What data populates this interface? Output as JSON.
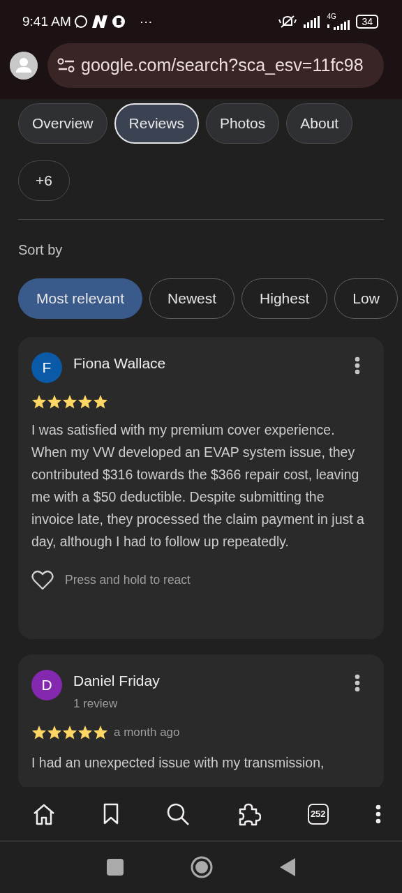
{
  "status_bar": {
    "time": "9:41 AM",
    "more": "···",
    "network": "4G",
    "battery": "34"
  },
  "address_bar": {
    "url": "google.com/search?sca_esv=11fc98"
  },
  "tabs": [
    {
      "label": "Overview",
      "selected": false
    },
    {
      "label": "Reviews",
      "selected": true
    },
    {
      "label": "Photos",
      "selected": false
    },
    {
      "label": "About",
      "selected": false
    }
  ],
  "more_tabs": "+6",
  "sort": {
    "label": "Sort by",
    "options": [
      {
        "label": "Most relevant",
        "selected": true
      },
      {
        "label": "Newest",
        "selected": false
      },
      {
        "label": "Highest",
        "selected": false
      },
      {
        "label": "Low",
        "selected": false
      }
    ]
  },
  "reviews": [
    {
      "initial": "F",
      "color": "#0b5aa8",
      "name": "Fiona Wallace",
      "stars": 5,
      "text": "I was satisfied with my premium cover experience. When my VW developed an EVAP system issue, they contributed $316 towards the $366 repair cost, leaving me with a $50 deductible. Despite submitting the invoice late, they processed the claim payment in just a day, although I had to follow up repeatedly.",
      "react_hint": "Press and hold to react"
    },
    {
      "initial": "D",
      "color": "#8428b0",
      "name": "Daniel Friday",
      "subtitle": "1 review",
      "stars": 5,
      "time": "a month ago",
      "text": "I had an unexpected issue with my transmission,"
    }
  ],
  "toolbar": {
    "tab_count": "252"
  }
}
